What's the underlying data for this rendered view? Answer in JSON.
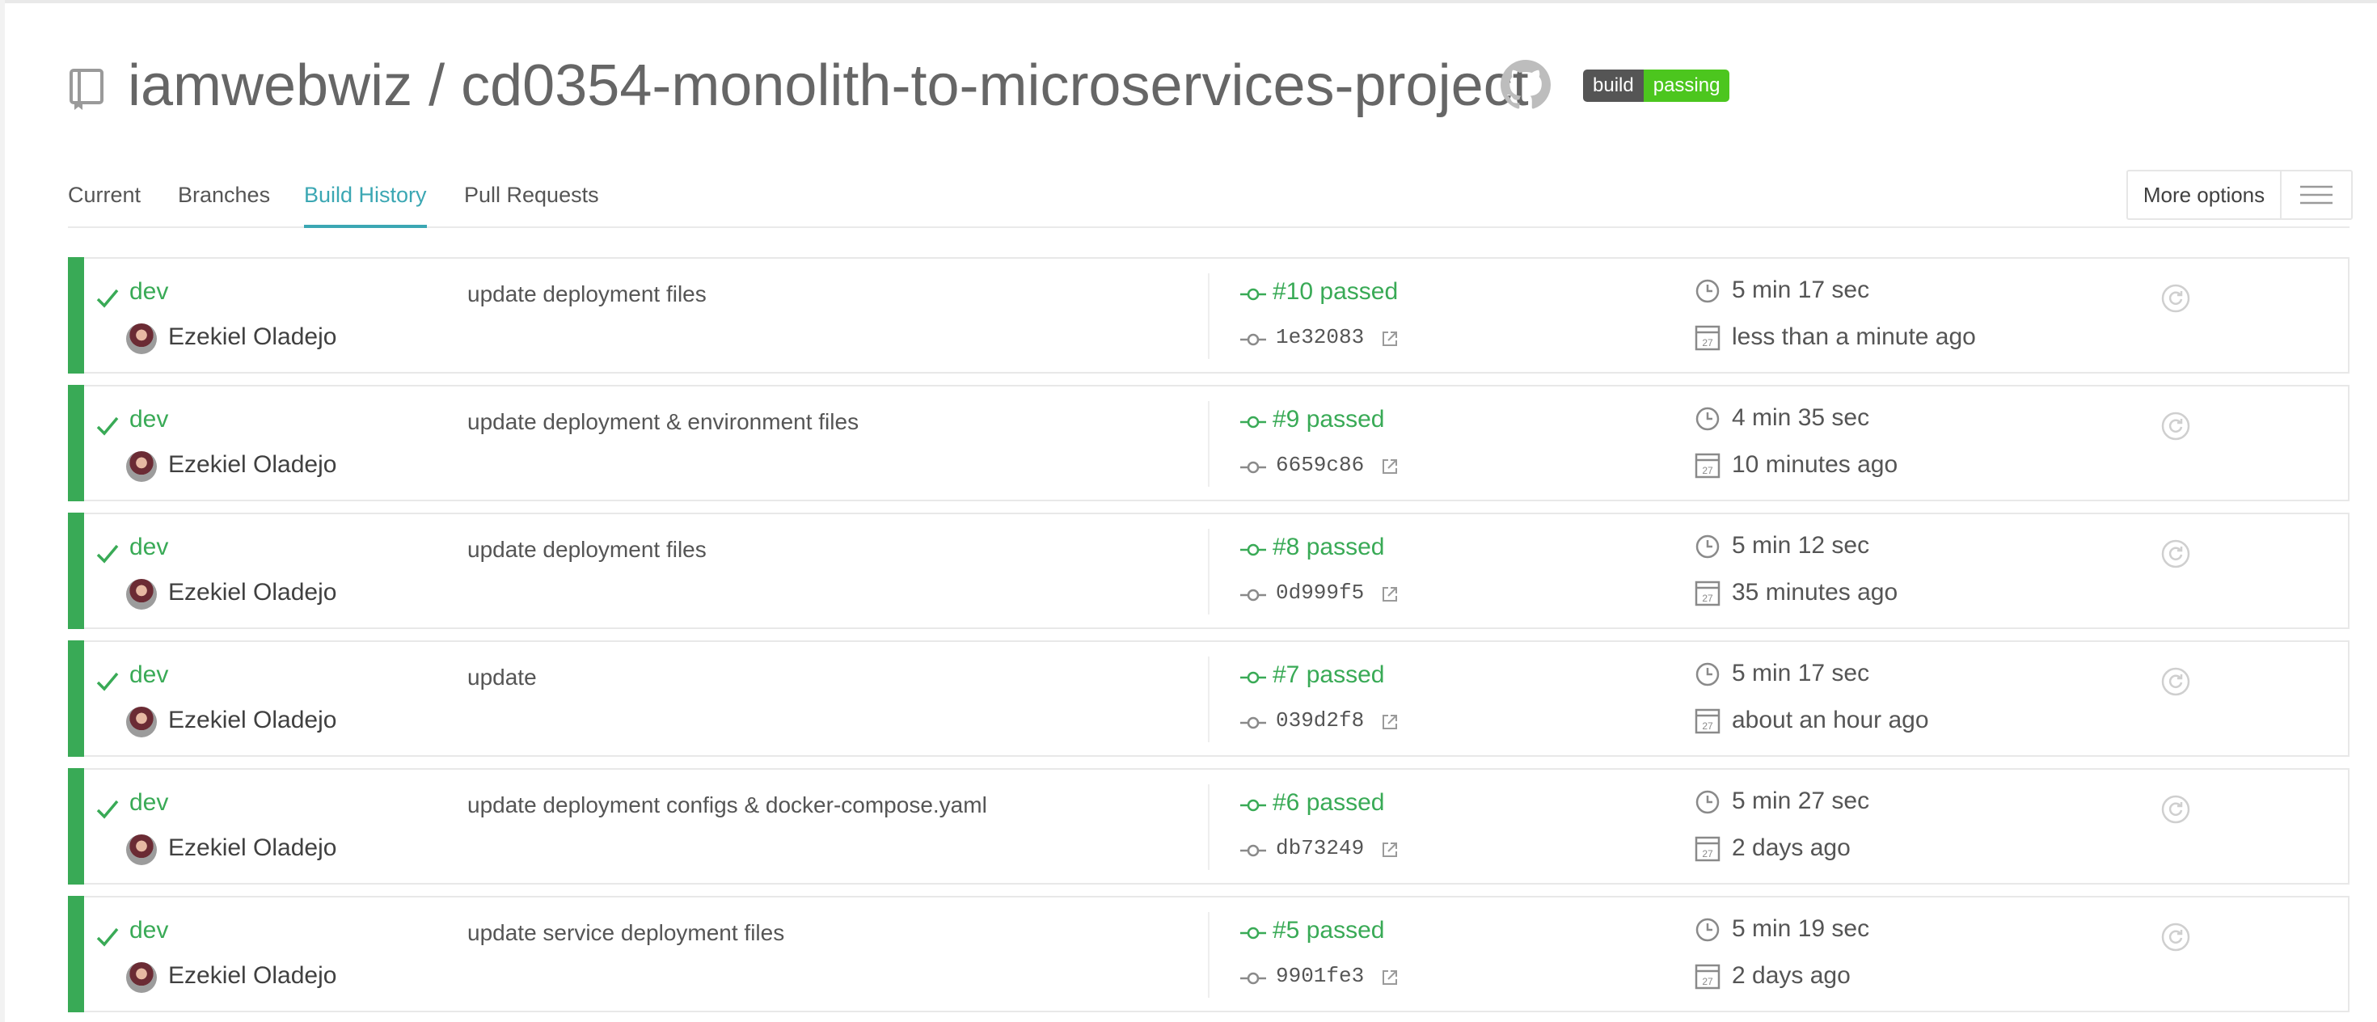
{
  "repo": {
    "owner": "iamwebwiz",
    "separator": "/",
    "name": "cd0354-monolith-to-microservices-project",
    "badge_left": "build",
    "badge_right": "passing"
  },
  "tabs": [
    "Current",
    "Branches",
    "Build History",
    "Pull Requests"
  ],
  "active_tab": "Build History",
  "more_options": "More options",
  "colors": {
    "passed": "#39aa56",
    "active_tab": "#3ba7b3",
    "badge_pass": "#4cc61e"
  },
  "builds": [
    {
      "branch": "dev",
      "author": "Ezekiel Oladejo",
      "message": "update deployment files",
      "build": "#10 passed",
      "sha": "1e32083",
      "duration": "5 min 17 sec",
      "finished": "less than a minute ago"
    },
    {
      "branch": "dev",
      "author": "Ezekiel Oladejo",
      "message": "update deployment & environment files",
      "build": "#9 passed",
      "sha": "6659c86",
      "duration": "4 min 35 sec",
      "finished": "10 minutes ago"
    },
    {
      "branch": "dev",
      "author": "Ezekiel Oladejo",
      "message": "update deployment files",
      "build": "#8 passed",
      "sha": "0d999f5",
      "duration": "5 min 12 sec",
      "finished": "35 minutes ago"
    },
    {
      "branch": "dev",
      "author": "Ezekiel Oladejo",
      "message": "update",
      "build": "#7 passed",
      "sha": "039d2f8",
      "duration": "5 min 17 sec",
      "finished": "about an hour ago"
    },
    {
      "branch": "dev",
      "author": "Ezekiel Oladejo",
      "message": "update deployment configs & docker-compose.yaml",
      "build": "#6 passed",
      "sha": "db73249",
      "duration": "5 min 27 sec",
      "finished": "2 days ago"
    },
    {
      "branch": "dev",
      "author": "Ezekiel Oladejo",
      "message": "update service deployment files",
      "build": "#5 passed",
      "sha": "9901fe3",
      "duration": "5 min 19 sec",
      "finished": "2 days ago"
    }
  ]
}
